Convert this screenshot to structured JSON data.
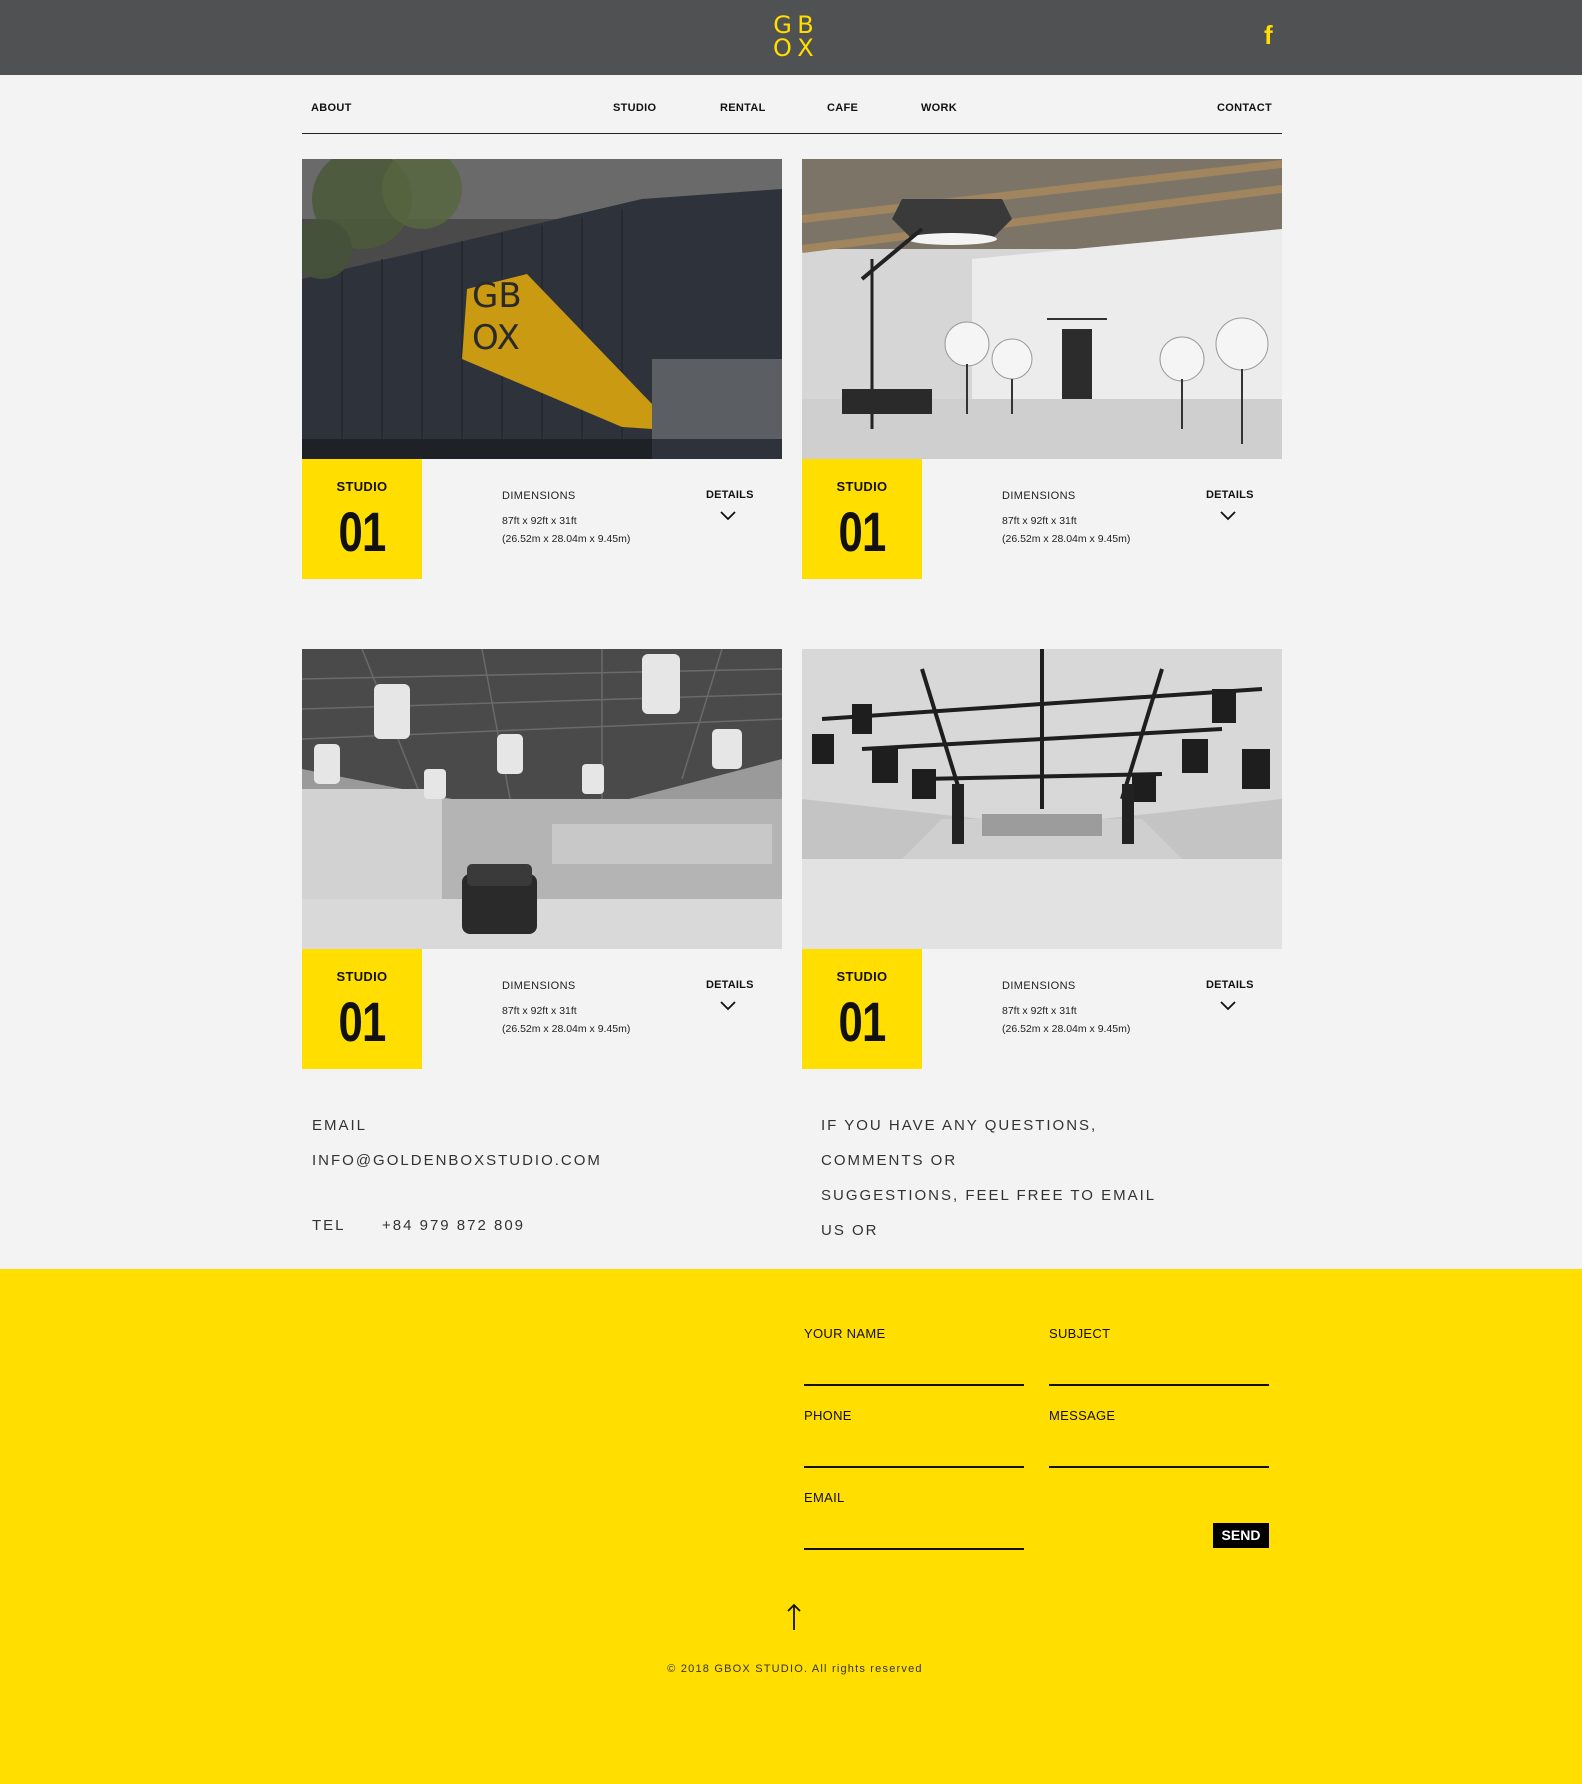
{
  "header": {
    "logo_letters": [
      "G",
      "B",
      "O",
      "X"
    ],
    "facebook_glyph": "f",
    "brand_color": "#ffde00",
    "bar_color": "#505153"
  },
  "nav": {
    "items": [
      {
        "label": "ABOUT"
      },
      {
        "label": "STUDIO"
      },
      {
        "label": "RENTAL"
      },
      {
        "label": "CAFE"
      },
      {
        "label": "WORK"
      },
      {
        "label": "CONTACT"
      }
    ]
  },
  "studios": [
    {
      "badge_label": "STUDIO",
      "number": "01",
      "dimensions_title": "DIMENSIONS",
      "dim_imperial": "87ft x 92ft x 31ft",
      "dim_metric": "(26.52m x 28.04m x 9.45m)",
      "details_label": "DETAILS",
      "image": "building-exterior-gbox-logo"
    },
    {
      "badge_label": "STUDIO",
      "number": "01",
      "dimensions_title": "DIMENSIONS",
      "dim_imperial": "87ft x 92ft x 31ft",
      "dim_metric": "(26.52m x 28.04m x 9.45m)",
      "details_label": "DETAILS",
      "image": "photo-studio-lighting"
    },
    {
      "badge_label": "STUDIO",
      "number": "01",
      "dimensions_title": "DIMENSIONS",
      "dim_imperial": "87ft x 92ft x 31ft",
      "dim_metric": "(26.52m x 28.04m x 9.45m)",
      "details_label": "DETAILS",
      "image": "warehouse-studio-car"
    },
    {
      "badge_label": "STUDIO",
      "number": "01",
      "dimensions_title": "DIMENSIONS",
      "dim_imperial": "87ft x 92ft x 31ft",
      "dim_metric": "(26.52m x 28.04m x 9.45m)",
      "details_label": "DETAILS",
      "image": "hall-stage-lighting-rig"
    }
  ],
  "contact": {
    "email_label": "EMAIL",
    "email_value": "INFO@GOLDENBOXSTUDIO.COM",
    "tel_label": "TEL",
    "tel_value": "+84 979 872 809",
    "message_lines": [
      "IF YOU HAVE ANY QUESTIONS,",
      "COMMENTS OR",
      "SUGGESTIONS, FEEL FREE TO EMAIL",
      "US OR"
    ]
  },
  "form": {
    "name_label": "YOUR NAME",
    "subject_label": "SUBJECT",
    "phone_label": "PHONE",
    "message_label": "MESSAGE",
    "email_label": "EMAIL",
    "send_label": "SEND"
  },
  "footer": {
    "back_to_top_glyph": "↑",
    "copyright": "© 2018 GBOX STUDIO. All rights reserved"
  }
}
